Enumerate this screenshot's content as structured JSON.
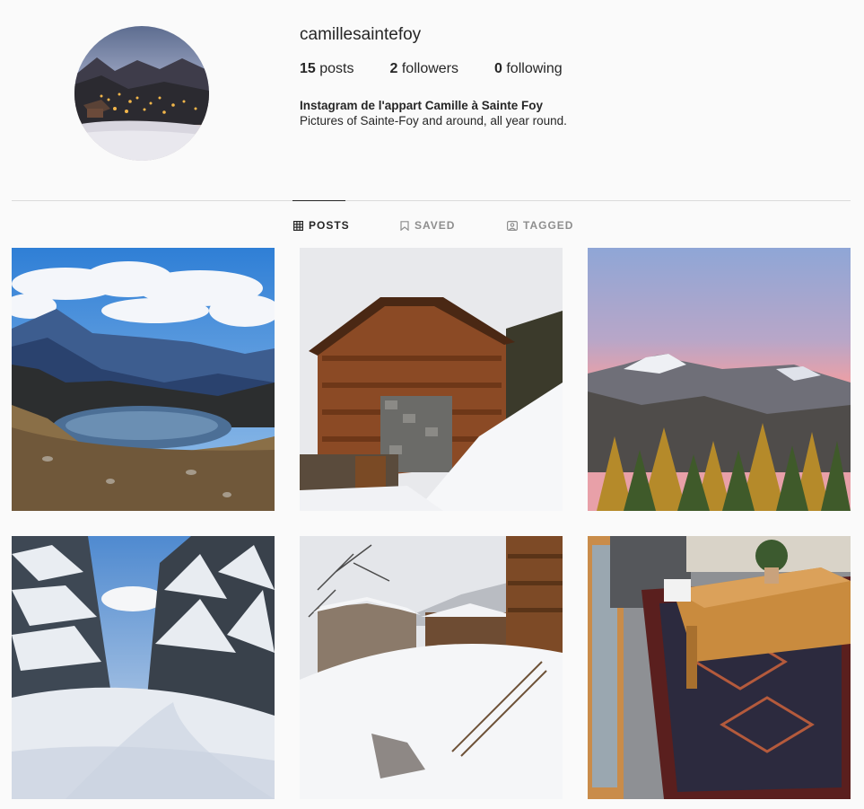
{
  "profile": {
    "username": "camillesaintefoy",
    "stats": [
      {
        "count": "15",
        "label": "posts"
      },
      {
        "count": "2",
        "label": "followers"
      },
      {
        "count": "0",
        "label": "following"
      }
    ],
    "bio_name": "Instagram de l'appart Camille à Sainte Foy",
    "bio_text": "Pictures of Sainte-Foy and around, all year round."
  },
  "tabs": [
    {
      "label": "POSTS",
      "icon": "grid-icon",
      "active": true
    },
    {
      "label": "SAVED",
      "icon": "bookmark-icon",
      "active": false
    },
    {
      "label": "TAGGED",
      "icon": "tag-icon",
      "active": false
    }
  ],
  "posts": [
    {
      "subject": "mountain-lake"
    },
    {
      "subject": "wooden-chalet-snow"
    },
    {
      "subject": "sunset-peaks-larches"
    },
    {
      "subject": "snowy-forest-path"
    },
    {
      "subject": "snowy-village"
    },
    {
      "subject": "living-room-coffee-table"
    }
  ]
}
